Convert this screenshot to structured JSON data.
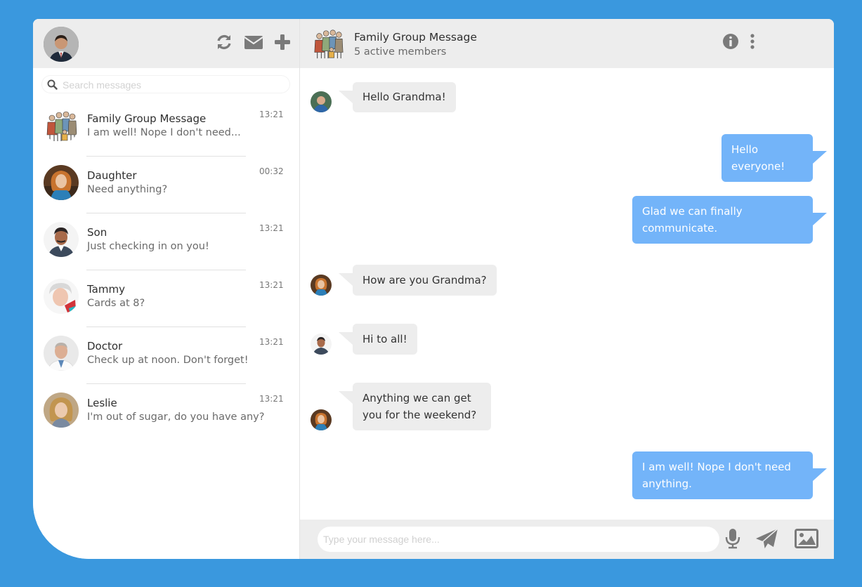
{
  "colors": {
    "background": "#3a98de",
    "outgoing_bubble": "#73b4f9",
    "incoming_bubble": "#ededed",
    "header": "#ededed"
  },
  "sidebar": {
    "header_icons": [
      "refresh-icon",
      "envelope-icon",
      "plus-icon"
    ],
    "search": {
      "placeholder": "Search messages"
    },
    "conversations": [
      {
        "name": "Family Group Message",
        "preview": "I am well! Nope I don't need...",
        "time": "13:21",
        "avatar": "family-group-avatar"
      },
      {
        "name": "Daughter",
        "preview": "Need anything?",
        "time": "00:32",
        "avatar": "daughter-avatar"
      },
      {
        "name": "Son",
        "preview": "Just checking in on you!",
        "time": "13:21",
        "avatar": "son-avatar"
      },
      {
        "name": "Tammy",
        "preview": "Cards at 8?",
        "time": "13:21",
        "avatar": "tammy-avatar"
      },
      {
        "name": "Doctor",
        "preview": "Check up at noon. Don't forget!",
        "time": "13:21",
        "avatar": "doctor-avatar"
      },
      {
        "name": "Leslie",
        "preview": "I'm out of sugar, do you have any?",
        "time": "13:21",
        "avatar": "leslie-avatar"
      }
    ]
  },
  "chat": {
    "title": "Family Group Message",
    "subtitle": "5 active members",
    "header_icons": [
      "info-icon",
      "kebab-menu-icon"
    ],
    "messages": [
      {
        "direction": "incoming",
        "sender": "grandson",
        "lines": [
          "Hello Grandma!"
        ]
      },
      {
        "direction": "outgoing",
        "lines": [
          "Hello",
          "everyone!"
        ]
      },
      {
        "direction": "outgoing",
        "lines": [
          "Glad we can finally",
          "communicate."
        ]
      },
      {
        "direction": "incoming",
        "sender": "daughter",
        "lines": [
          "How are you Grandma?"
        ]
      },
      {
        "direction": "incoming",
        "sender": "son",
        "lines": [
          "Hi to all!"
        ]
      },
      {
        "direction": "incoming",
        "sender": "daughter",
        "lines": [
          "Anything we can get",
          "you for the weekend?"
        ]
      },
      {
        "direction": "outgoing",
        "lines": [
          "I am well! Nope I don't need",
          "anything."
        ]
      }
    ],
    "composer": {
      "placeholder": "Type your message here...",
      "icons": [
        "microphone-icon",
        "send-icon",
        "image-icon"
      ]
    }
  }
}
